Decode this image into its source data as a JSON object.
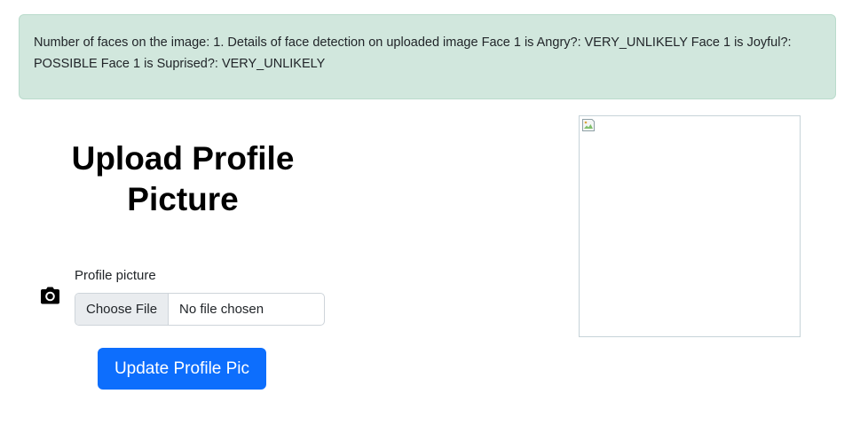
{
  "alert": {
    "message": "Number of faces on the image: 1. Details of face detection on uploaded image Face 1 is Angry?: VERY_UNLIKELY Face 1 is Joyful?: POSSIBLE Face 1 is Suprised?: VERY_UNLIKELY"
  },
  "form": {
    "title": "Upload Profile Picture",
    "field_label": "Profile picture",
    "choose_file_label": "Choose File",
    "no_file_text": "No file chosen",
    "submit_label": "Update Profile Pic",
    "camera_icon": "camera-icon"
  },
  "preview": {
    "icon": "broken-image-icon"
  },
  "colors": {
    "alert_bg": "#d1e7dd",
    "primary": "#0d6efd"
  }
}
